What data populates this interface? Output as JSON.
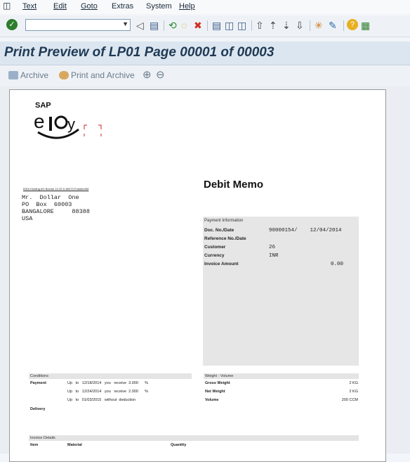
{
  "menu": [
    {
      "label": "Text"
    },
    {
      "label": "Edit"
    },
    {
      "label": "Goto"
    },
    {
      "label": "Extras"
    },
    {
      "label": "System"
    },
    {
      "label": "Help"
    }
  ],
  "toolbar": {
    "command_value": ""
  },
  "page": {
    "title": "Print Preview of LP01 Page 00001 of 00003"
  },
  "app_toolbar": {
    "archive": "Archive",
    "print_archive": "Print and Archive"
  },
  "doc": {
    "logo_text": "SAP",
    "sender_line": "IDEA Holding AG Boerse 10 20 D-60070 Frankfurt/M",
    "address": [
      "Mr.  Dollar  One",
      "PO  Box  60003",
      "BANGALORE     88388",
      "USA"
    ],
    "title": "Debit  Memo",
    "info_header": "Payment   Information",
    "info_rows": [
      {
        "label": "Doc.  No./Date",
        "value": "90000154/    12/04/2014"
      },
      {
        "label": "Reference  No./Date",
        "value": ""
      },
      {
        "label": "Customer",
        "value": "26"
      },
      {
        "label": "Currency",
        "value": "INR"
      }
    ],
    "invoice_amount_label": "Invoice  Amount",
    "invoice_amount": "0.00",
    "conditions_header": "Conditions",
    "payment_label": "Payment",
    "payment_terms": [
      "Up   to   12/18/2014   you   receive  3.000      %",
      "Up   to   12/24/2014   you   receive  2.000      %",
      "Up   to   01/03/2015   without  deduction"
    ],
    "delivery_label": "Delivery",
    "weight_header": "Weight  -  Volume",
    "weight_rows": [
      {
        "label": "Gross  Weight",
        "value": "2 KG"
      },
      {
        "label": "Net  Weight",
        "value": "2 KG"
      },
      {
        "label": "Volume",
        "value": "200 CCM"
      }
    ],
    "invoice_details_header": "Invoice   Details",
    "detail_cols": [
      "Item",
      "Material",
      "Quantity"
    ]
  }
}
